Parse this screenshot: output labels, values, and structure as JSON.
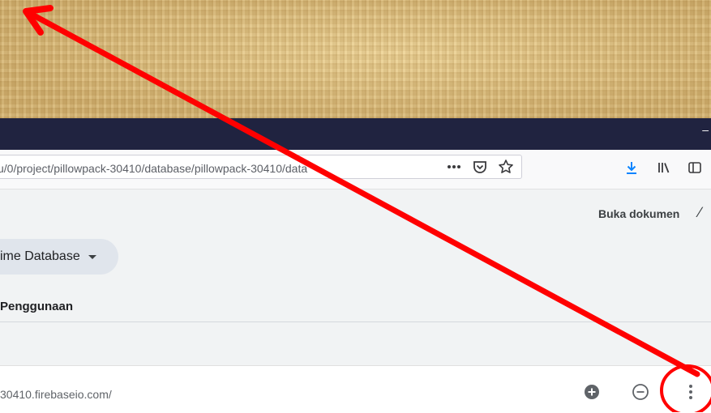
{
  "browser": {
    "address_url": "u/0/project/pillowpack-30410/database/pillowpack-30410/data",
    "minimize_glyph": "–"
  },
  "firebase": {
    "open_docs": "Buka dokumen",
    "open_docs_extra": "∕",
    "product_selector": "ime Database",
    "tab_usage": "Penggunaan",
    "database_url": "30410.firebaseio.com/"
  },
  "annotation": {
    "color": "#ff0000"
  }
}
